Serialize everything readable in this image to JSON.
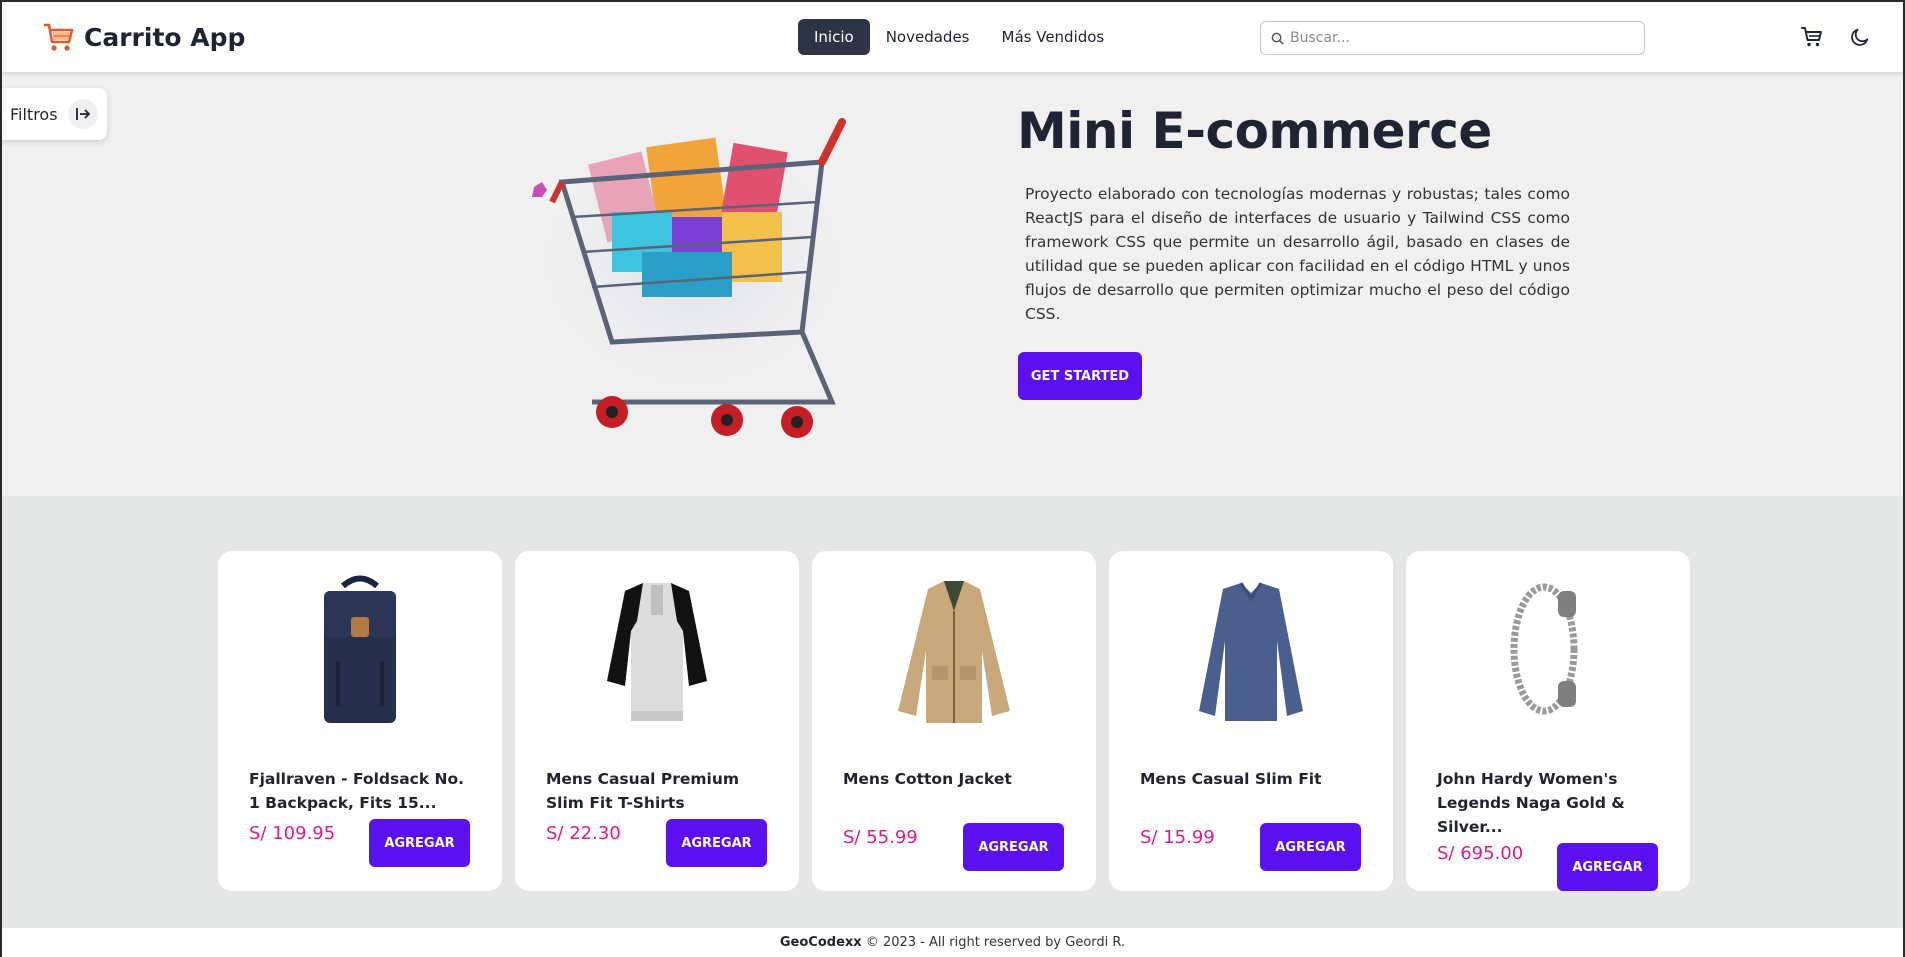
{
  "app": {
    "title": "Carrito App"
  },
  "nav": {
    "items": [
      {
        "label": "Inicio",
        "active": true
      },
      {
        "label": "Novedades",
        "active": false
      },
      {
        "label": "Más Vendidos",
        "active": false
      }
    ]
  },
  "search": {
    "placeholder": "Buscar...",
    "value": ""
  },
  "filters": {
    "label": "Filtros"
  },
  "hero": {
    "title": "Mini E-commerce",
    "description": "Proyecto elaborado con tecnologías modernas y robustas; tales como ReactJS para el diseño de interfaces de usuario y Tailwind CSS como framework CSS que permite un desarrollo ágil, basado en clases de utilidad que se pueden aplicar con facilidad en el código HTML y unos flujos de desarrollo que permiten optimizar mucho el peso del código CSS.",
    "cta": "GET STARTED"
  },
  "products": [
    {
      "name": "Fjallraven - Foldsack No. 1 Backpack, Fits 15...",
      "price": "S/ 109.95",
      "button": "AGREGAR",
      "icon": "backpack-image"
    },
    {
      "name": "Mens Casual Premium Slim Fit T-Shirts",
      "price": "S/ 22.30",
      "button": "AGREGAR",
      "icon": "tshirt-image"
    },
    {
      "name": "Mens Cotton Jacket",
      "price": "S/ 55.99",
      "button": "AGREGAR",
      "icon": "jacket-image"
    },
    {
      "name": "Mens Casual Slim Fit",
      "price": "S/ 15.99",
      "button": "AGREGAR",
      "icon": "longsleeve-image"
    },
    {
      "name": "John Hardy Women's Legends Naga Gold & Silver...",
      "price": "S/ 695.00",
      "button": "AGREGAR",
      "icon": "bracelet-image"
    }
  ],
  "footer": {
    "brand": "GeoCodexx",
    "text": "© 2023 - All right reserved by Geordi R."
  },
  "colors": {
    "accent": "#5b10f0",
    "price": "#e01c8c",
    "nav_active": "#2c3445"
  }
}
